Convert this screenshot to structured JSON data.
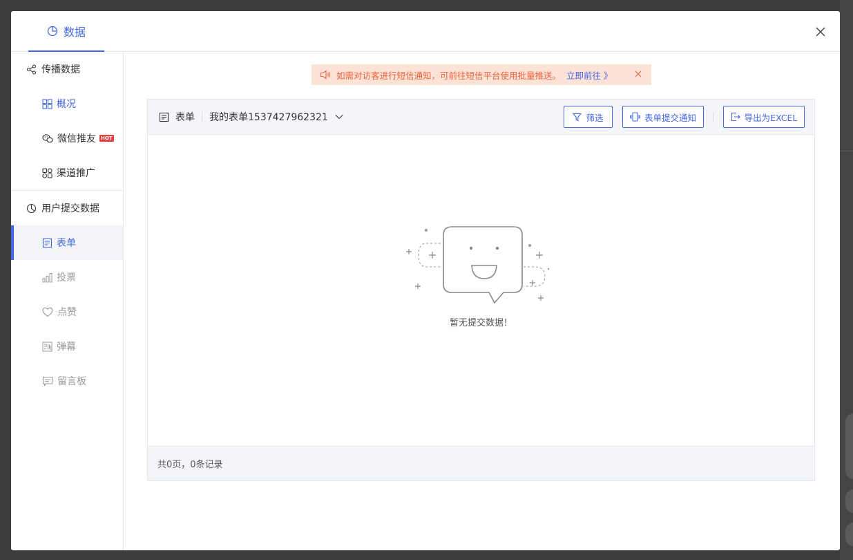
{
  "header": {
    "tab_label": "数据"
  },
  "sidebar": {
    "groups": [
      {
        "label": "传播数据"
      },
      {
        "label": "用户提交数据"
      }
    ],
    "spread_items": [
      {
        "label": "概况"
      },
      {
        "label": "微信推友",
        "badge": "HOT"
      },
      {
        "label": "渠道推广"
      }
    ],
    "submit_items": [
      {
        "label": "表单",
        "active": true
      },
      {
        "label": "投票"
      },
      {
        "label": "点赞"
      },
      {
        "label": "弹幕"
      },
      {
        "label": "留言板"
      }
    ]
  },
  "notice": {
    "text": "如需对访客进行短信通知，可前往短信平台使用批量推送。",
    "link": "立即前往 》"
  },
  "toolbar": {
    "form_label": "表单",
    "selected_form": "我的表单1537427962321",
    "filter_button": "筛选",
    "notify_button": "表单提交通知",
    "export_button": "导出为EXCEL"
  },
  "empty_state": {
    "message": "暂无提交数据！"
  },
  "footer": {
    "summary": "共0页，0条记录"
  },
  "colors": {
    "accent": "#4467e4",
    "notice_bg": "#fde2d7",
    "notice_text": "#e8633a",
    "hot_badge": "#e64040"
  }
}
